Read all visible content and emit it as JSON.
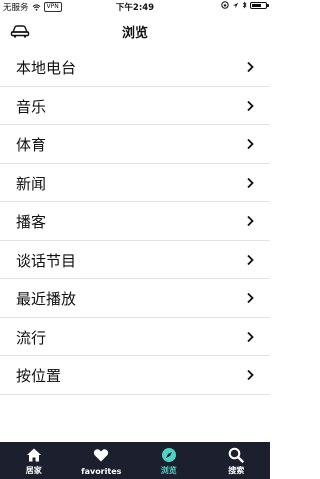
{
  "status_bar": {
    "carrier": "无服务",
    "vpn": "VPN",
    "time": "下午2:49"
  },
  "header": {
    "title": "浏览",
    "left_icon": "car-icon"
  },
  "list": {
    "items": [
      {
        "label": "本地电台"
      },
      {
        "label": "音乐"
      },
      {
        "label": "体育"
      },
      {
        "label": "新闻"
      },
      {
        "label": "播客"
      },
      {
        "label": "谈话节目"
      },
      {
        "label": "最近播放"
      },
      {
        "label": "流行"
      },
      {
        "label": "按位置"
      }
    ]
  },
  "tabbar": {
    "tabs": [
      {
        "label": "居家",
        "icon": "home-icon"
      },
      {
        "label": "favorites",
        "icon": "heart-icon"
      },
      {
        "label": "浏览",
        "icon": "compass-icon",
        "active": true
      },
      {
        "label": "搜索",
        "icon": "search-icon"
      }
    ],
    "accent": "#4fd1c5",
    "background": "#1c1f2e"
  }
}
